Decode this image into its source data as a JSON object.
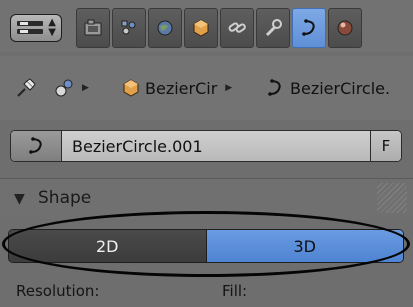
{
  "properties_tabs": [
    {
      "icon": "render-camera-icon",
      "active": false
    },
    {
      "icon": "render-layers-icon",
      "active": false
    },
    {
      "icon": "world-icon",
      "active": false
    },
    {
      "icon": "object-cube-icon",
      "active": false
    },
    {
      "icon": "constraint-link-icon",
      "active": false
    },
    {
      "icon": "modifier-wrench-icon",
      "active": false
    },
    {
      "icon": "curve-data-icon",
      "active": true
    },
    {
      "icon": "material-sphere-icon",
      "active": false
    }
  ],
  "breadcrumb": {
    "object_name": "BezierCir",
    "data_name": "BezierCircle."
  },
  "datablock": {
    "name": "BezierCircle.001",
    "fake_user_label": "F"
  },
  "shape_panel": {
    "title": "Shape",
    "dimension_options": [
      "2D",
      "3D"
    ],
    "selected_dimension": "3D",
    "resolution_label": "Resolution:",
    "fill_label": "Fill:"
  },
  "colors": {
    "active_blue": "#5f8fd6",
    "panel_gray": "#6e6e6e"
  }
}
